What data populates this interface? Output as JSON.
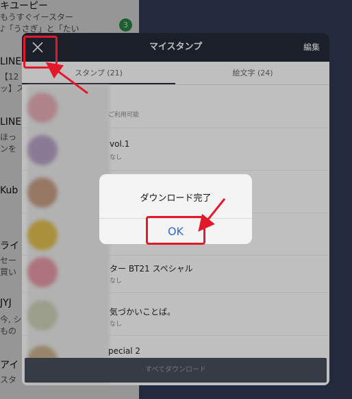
{
  "background_chats": [
    {
      "title": "キユーピー",
      "sub1": "もうすぐイースター",
      "sub2": "♪「うさぎ」と「たい",
      "badge": "3"
    },
    {
      "title": "LINE",
      "sub1": "【12",
      "sub2": "ッ】ス"
    },
    {
      "title": "LINE",
      "sub1": "ほっ",
      "sub2": "ンを"
    },
    {
      "title": "Kub",
      "sub1": "",
      "sub2": ""
    },
    {
      "title": "ライ",
      "sub1": "セー",
      "sub2": "買い"
    },
    {
      "title": "JYJ",
      "sub1": "今, シ",
      "sub2": "もの"
    },
    {
      "title": "アイ",
      "sub1": "スタ",
      "sub2": ""
    }
  ],
  "panel": {
    "title": "マイスタンプ",
    "edit_label": "編集",
    "close_icon": "close-icon",
    "tabs": [
      {
        "label": "スタンプ (21)",
        "active": true
      },
      {
        "label": "絵文字 (24)",
        "active": false
      }
    ],
    "rows": [
      {
        "name": "",
        "sub": "ご利用可能"
      },
      {
        "name": "vol.1",
        "sub": "なし"
      },
      {
        "name": "",
        "sub": ""
      },
      {
        "name": "",
        "sub": ""
      },
      {
        "name": "ター BT21 スペシャル",
        "sub": "なし"
      },
      {
        "name": "気づかいことば。",
        "sub": "なし"
      },
      {
        "name": "pecial 2",
        "sub": ""
      }
    ],
    "download_all_label": "すべてダウンロード"
  },
  "alert": {
    "message": "ダウンロード完了",
    "ok_label": "OK"
  },
  "colors": {
    "header_bg": "#242a38",
    "ok_blue": "#2f6bd8",
    "annotation_red": "#e3192b",
    "badge_green": "#2e9a4a"
  }
}
